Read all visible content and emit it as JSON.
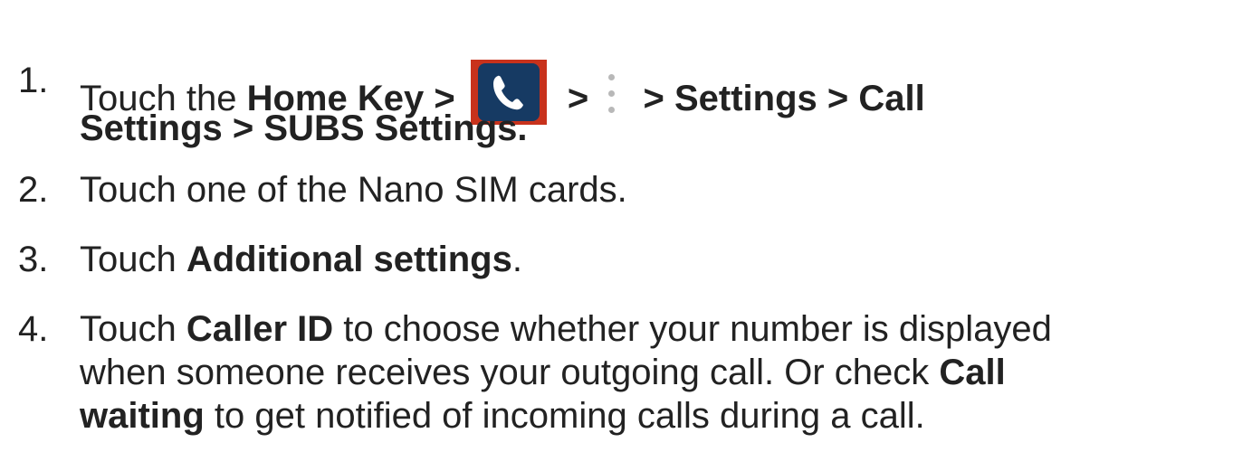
{
  "steps": [
    {
      "number": "1.",
      "lead": "Touch the ",
      "home_key": "Home Key",
      "sep1": " > ",
      "sep2": " > ",
      "sep3": " > ",
      "settings": "Settings",
      "sep4": " > ",
      "call": "Call",
      "line2": "Settings > SUBS Settings.",
      "icons": [
        "phone-app-icon",
        "more-options-icon"
      ],
      "icon_colors": {
        "frame": "#c8321c",
        "tile": "#163a63",
        "glyph": "#ffffff",
        "dots": "#b8b8b8"
      }
    },
    {
      "number": "2.",
      "text": "Touch one of the Nano SIM cards."
    },
    {
      "number": "3.",
      "lead": "Touch ",
      "bold": "Additional settings",
      "tail": "."
    },
    {
      "number": "4.",
      "line1_lead": "Touch ",
      "caller_id": "Caller ID",
      "line1_tail": " to choose whether your number is displayed",
      "line2_lead": "when someone receives your outgoing call. Or check ",
      "call": "Call",
      "waiting": "waiting",
      "line3_tail": " to get notified of incoming calls during a call."
    }
  ]
}
